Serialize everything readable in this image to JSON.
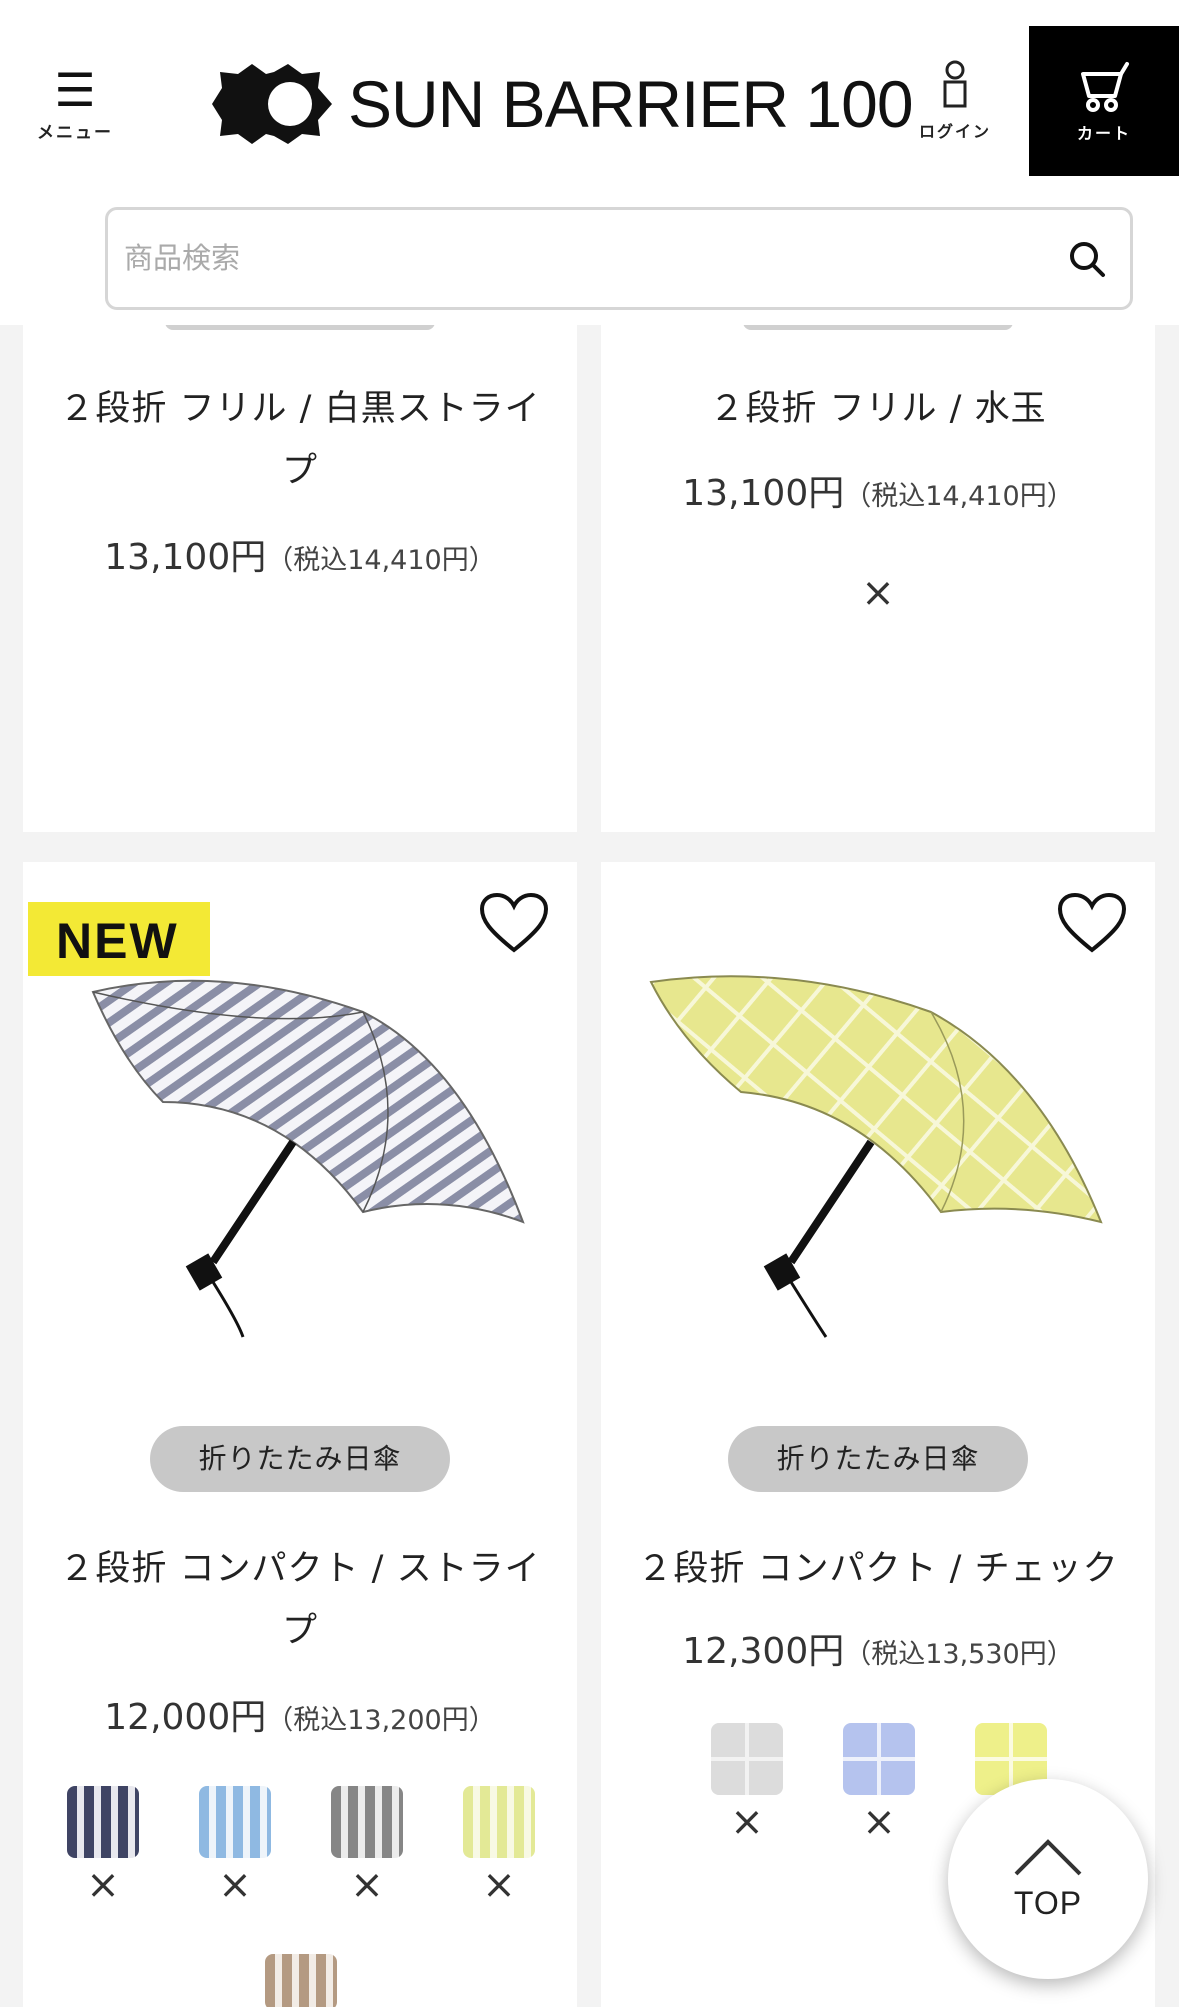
{
  "header": {
    "menu_label": "メニュー",
    "brand": "SUN BARRIER 100",
    "login_label": "ログイン",
    "cart_label": "カート"
  },
  "search": {
    "placeholder": "商品検索"
  },
  "products": [
    {
      "name_line1": "２段折 フリル / 白黒ストライ",
      "name_line2": "プ",
      "price": "13,100円",
      "tax": "（税込14,410円）"
    },
    {
      "name_line1": "２段折 フリル / 水玉",
      "price": "13,100円",
      "tax": "（税込14,410円）",
      "unavailable": "×"
    },
    {
      "badge": "NEW",
      "category": "折りたたみ日傘",
      "name_line1": "２段折 コンパクト / ストライ",
      "name_line2": "プ",
      "price": "12,000円",
      "tax": "（税込13,200円）",
      "swatches": [
        {
          "pattern": "navy-stripe",
          "color": "#4a4f6e",
          "status": "×"
        },
        {
          "pattern": "blue-stripe",
          "color": "#8fb9e2",
          "status": "×"
        },
        {
          "pattern": "gray-stripe",
          "color": "#8d8d8d",
          "status": "×"
        },
        {
          "pattern": "yellow-stripe",
          "color": "#e6eb9a",
          "status": "×"
        },
        {
          "pattern": "beige-stripe",
          "color": "#b49a82"
        }
      ]
    },
    {
      "category": "折りたたみ日傘",
      "name_line1": "２段折 コンパクト / チェック",
      "price": "12,300円",
      "tax": "（税込13,530円）",
      "swatches": [
        {
          "pattern": "gray-check",
          "color": "#dcdcdc",
          "status": "×"
        },
        {
          "pattern": "blue-check",
          "color": "#b5c3ee",
          "status": "×"
        },
        {
          "pattern": "yellow-check",
          "color": "#eef08a"
        }
      ]
    }
  ],
  "top_button": {
    "label": "TOP"
  },
  "colors": {
    "badge": "#f3e935",
    "pill": "#c8c8c8",
    "cart_bg": "#000000"
  }
}
